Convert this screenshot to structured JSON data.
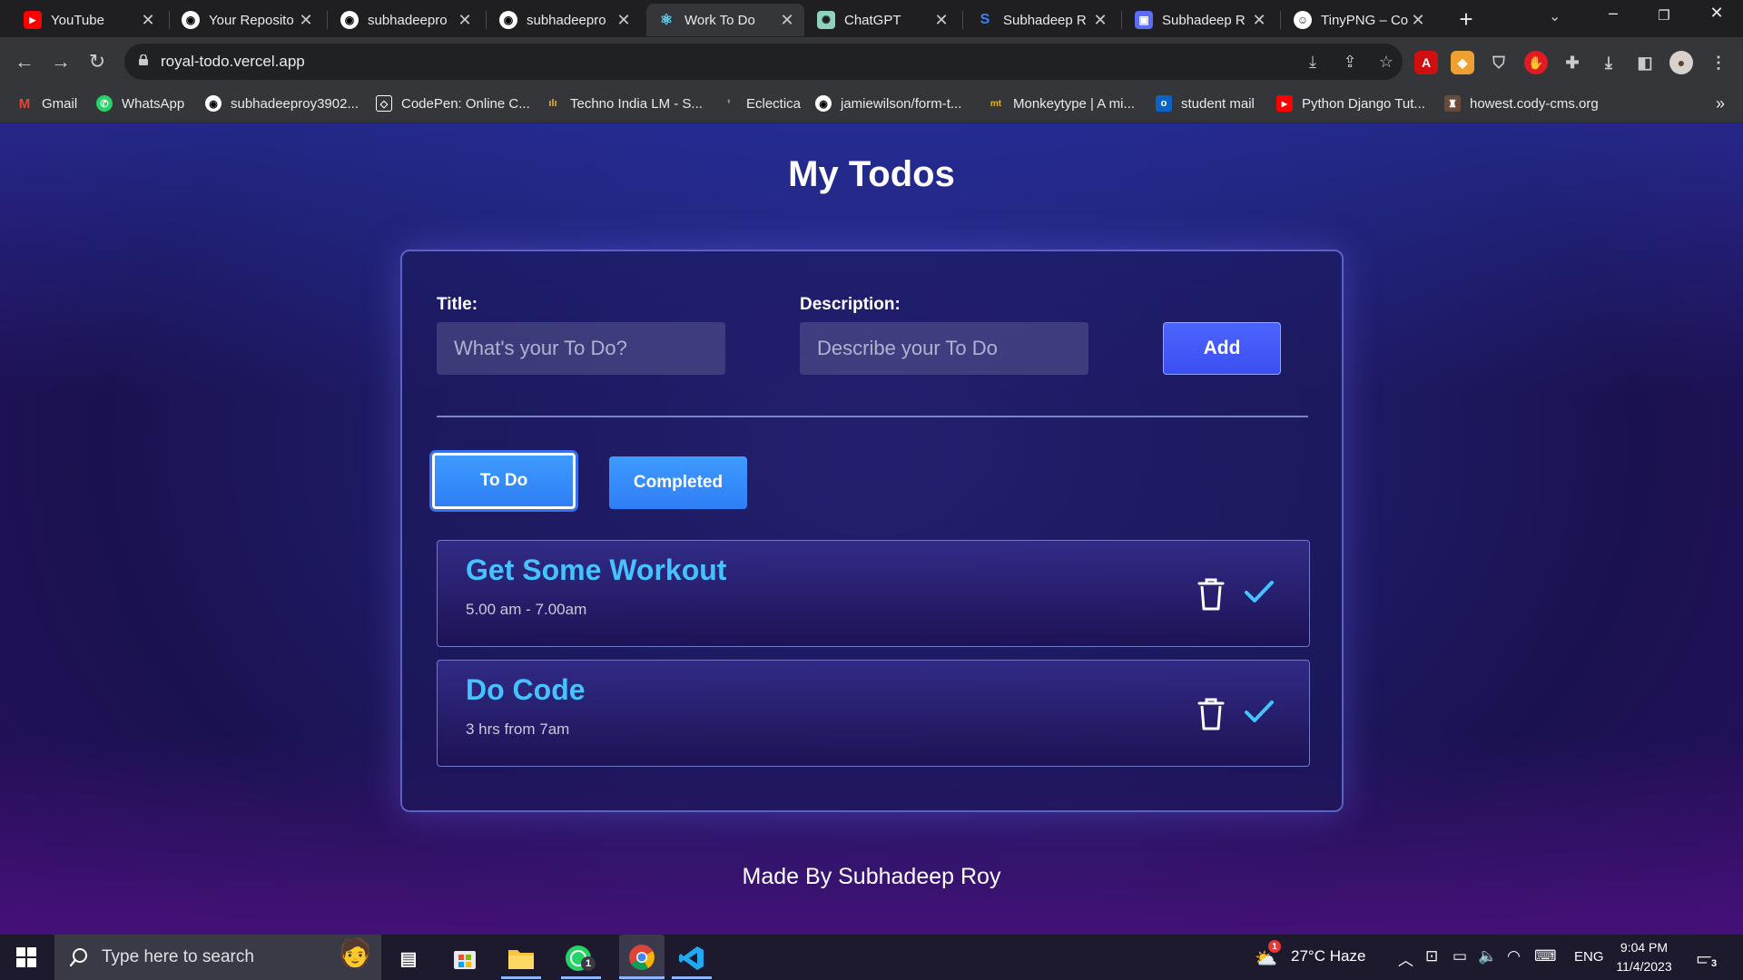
{
  "browser": {
    "tabs": [
      {
        "title": "YouTube",
        "icon": "youtube-icon",
        "active": false
      },
      {
        "title": "Your Reposito",
        "icon": "github-icon",
        "active": false
      },
      {
        "title": "subhadeepro",
        "icon": "github-icon",
        "active": false
      },
      {
        "title": "subhadeepro",
        "icon": "github-icon",
        "active": false
      },
      {
        "title": "Work To Do",
        "icon": "react-icon",
        "active": true
      },
      {
        "title": "ChatGPT",
        "icon": "chatgpt-icon",
        "active": false
      },
      {
        "title": "Subhadeep R",
        "icon": "site-icon",
        "active": false
      },
      {
        "title": "Subhadeep R",
        "icon": "site-icon",
        "active": false
      },
      {
        "title": "TinyPNG – Co",
        "icon": "tinypng-icon",
        "active": false
      }
    ],
    "url": "royal-todo.vercel.app",
    "bookmarks": [
      {
        "label": "Gmail",
        "icon": "gmail-icon"
      },
      {
        "label": "WhatsApp",
        "icon": "whatsapp-icon"
      },
      {
        "label": "subhadeeproy3902...",
        "icon": "github-icon"
      },
      {
        "label": "CodePen: Online C...",
        "icon": "codepen-icon"
      },
      {
        "label": "Techno India LM - S...",
        "icon": "techno-india-icon"
      },
      {
        "label": "Eclectica",
        "icon": "eclectica-icon"
      },
      {
        "label": "jamiewilson/form-t...",
        "icon": "github-icon"
      },
      {
        "label": "Monkeytype | A mi...",
        "icon": "monkeytype-icon"
      },
      {
        "label": "student mail",
        "icon": "outlook-icon"
      },
      {
        "label": "Python Django Tut...",
        "icon": "youtube-icon"
      },
      {
        "label": "howest.cody-cms.org",
        "icon": "cody-icon"
      }
    ]
  },
  "app": {
    "heading": "My Todos",
    "form": {
      "title_label": "Title:",
      "title_placeholder": "What's your To Do?",
      "description_label": "Description:",
      "description_placeholder": "Describe your To Do",
      "add_label": "Add"
    },
    "tabs": [
      {
        "label": "To Do",
        "active": true
      },
      {
        "label": "Completed",
        "active": false
      }
    ],
    "todos": [
      {
        "title": "Get Some Workout",
        "description": "5.00 am - 7.00am"
      },
      {
        "title": "Do Code",
        "description": "3 hrs from 7am"
      }
    ],
    "footer": "Made By Subhadeep Roy",
    "colors": {
      "todo_title": "#46c3ff",
      "check": "#46c3ff",
      "add_button": "#4458f8",
      "tab_button": "#3a8cff"
    }
  },
  "taskbar": {
    "search_placeholder": "Type here to search",
    "whatsapp_badge": "1",
    "weather": "27°C  Haze",
    "weather_badge": "1",
    "language": "ENG",
    "time": "9:04 PM",
    "date": "11/4/2023",
    "notification_count": "3"
  }
}
